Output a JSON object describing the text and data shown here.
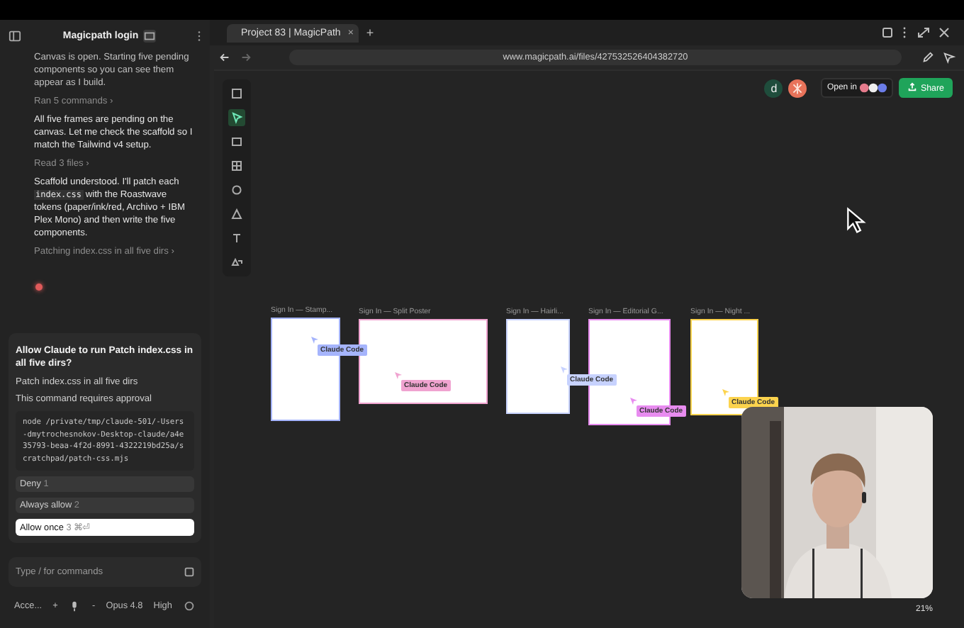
{
  "sidebar": {
    "title": "Magicpath login",
    "messages": [
      {
        "kind": "text",
        "text": "Canvas is open. Starting five pending components so you can see them appear as I build.",
        "faded": true
      },
      {
        "kind": "step",
        "text": "Ran 5 commands ›"
      },
      {
        "kind": "text",
        "text": "All five frames are pending on the canvas. Let me check the scaffold so I match the Tailwind v4 setup.",
        "faded": false
      },
      {
        "kind": "step",
        "text": "Read 3 files ›"
      },
      {
        "kind": "code_text",
        "before": "Scaffold understood. I'll patch each",
        "code": "index.css",
        "after": "with the Roastwave tokens (paper/ink/red, Archivo + IBM Plex Mono) and then write the five components."
      },
      {
        "kind": "step",
        "text": "Patching index.css in all five dirs ›"
      }
    ],
    "approval": {
      "title": "Allow Claude to run Patch index.css in all five dirs?",
      "subtitle": "Patch index.css in all five dirs",
      "note": "This command requires approval",
      "command": "node /private/tmp/claude-501/-Users-dmytrochesnokov-Desktop-claude/a4e35793-beaa-4f2d-8991-4322219bd25a/scratchpad/patch-css.mjs",
      "options": [
        {
          "label": "Deny",
          "key": "1",
          "selected": false
        },
        {
          "label": "Always allow",
          "key": "2",
          "selected": false
        },
        {
          "label": "Allow once",
          "key": "3 ⌘⏎",
          "selected": true
        }
      ]
    },
    "input": {
      "placeholder": "Type / for commands"
    },
    "footer": {
      "mode": "Acce...",
      "add": "+",
      "minus": "-",
      "model": "Opus 4.8",
      "effort": "High"
    }
  },
  "browser": {
    "tab": {
      "title": "Project 83 | MagicPath",
      "close": "×"
    },
    "new_tab": "+",
    "url": "www.magicpath.ai/files/427532526404382720"
  },
  "canvas": {
    "avatar": "d",
    "open_in": "Open in",
    "share": "Share",
    "zoom": "21%",
    "frames": [
      {
        "label": "Sign In — Stamp...",
        "tag": "Claude Code",
        "color": "#a5b4fc"
      },
      {
        "label": "Sign In — Split Poster",
        "tag": "Claude Code",
        "color": "#f0a3d0"
      },
      {
        "label": "Sign In — Hairli...",
        "tag": "Claude Code",
        "color": "#c7d2fe"
      },
      {
        "label": "Sign In — Editorial G...",
        "tag": "Claude Code",
        "color": "#e88cf0"
      },
      {
        "label": "Sign In — Night ...",
        "tag": "Claude Code",
        "color": "#fcd34d"
      }
    ]
  }
}
